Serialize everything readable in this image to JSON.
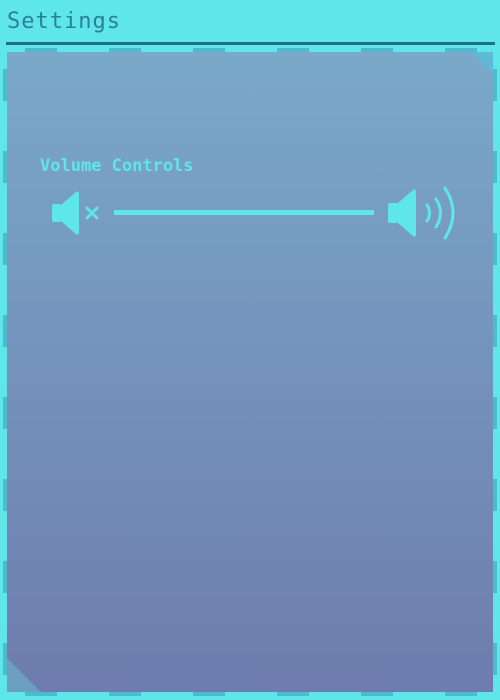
{
  "window": {
    "title": "Settings"
  },
  "volume": {
    "section_label": "Volume Controls",
    "mute_icon": "volume-mute-icon",
    "max_icon": "volume-max-icon",
    "level": 1.0
  },
  "colors": {
    "background": "#5ee6e8",
    "panel_top": "#7aa9c9",
    "panel_bottom": "#6e7cae",
    "accent": "#5ee6e8",
    "title_text": "#2b7f99",
    "rule": "#1f6f8a"
  }
}
